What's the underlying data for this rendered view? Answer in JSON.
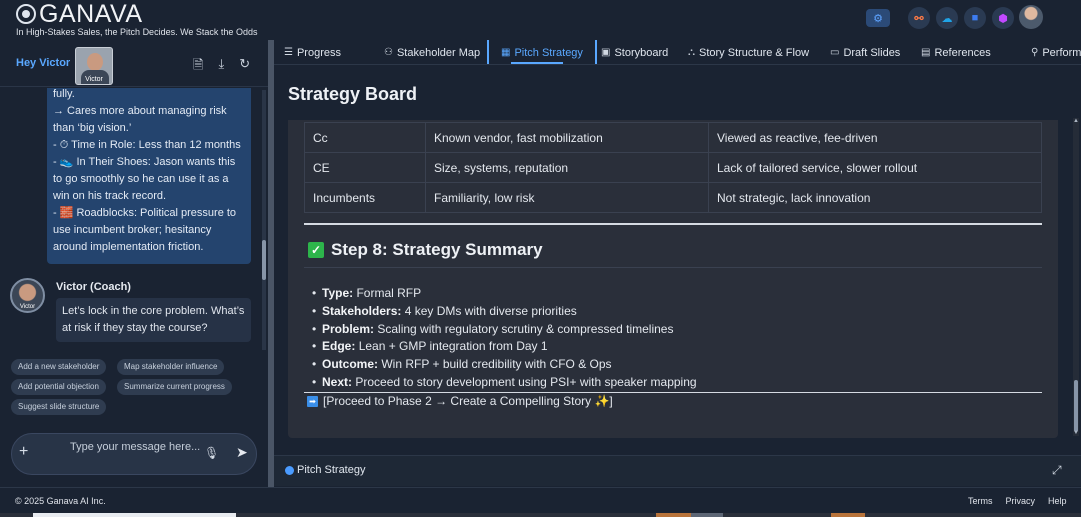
{
  "brand": {
    "name": "GANAVA",
    "tagline": "In High-Stakes Sales, the Pitch Decides. We Stack the Odds"
  },
  "top_icons": [
    "gear-icon",
    "hubspot-icon",
    "salesforce-icon",
    "app-icon",
    "gem-icon",
    "user-avatar"
  ],
  "left_panel": {
    "greeting": "Hey Victor",
    "avatar_label": "Victor",
    "user_message_lines": [
      "fully.",
      "  → Cares more about managing risk than ‘big vision.’",
      "- ⏱ Time in Role: Less than 12 months",
      "- 👟 In Their Shoes: Jason wants this to go smoothly so he can use it as a win on his track record.",
      "- 🧱 Roadblocks: Political pressure to use incumbent broker; hesitancy around implementation friction."
    ],
    "coach_name": "Victor (Coach)",
    "coach_message": "Let’s lock in the core problem. What’s at risk if they stay the course?",
    "chips": [
      "Add a new stakeholder",
      "Map stakeholder influence",
      "Add potential objection",
      "Summarize current progress",
      "Suggest slide structure"
    ],
    "input_placeholder": "Type your message here..."
  },
  "tabs": [
    {
      "label": "Progress",
      "icon": "list-icon"
    },
    {
      "label": "Stakeholder Map",
      "icon": "org-icon"
    },
    {
      "label": "Pitch Strategy",
      "icon": "board-icon",
      "active": true
    },
    {
      "label": "Storyboard",
      "icon": "note-icon"
    },
    {
      "label": "Story Structure & Flow",
      "icon": "tree-icon"
    },
    {
      "label": "Draft Slides",
      "icon": "monitor-icon"
    },
    {
      "label": "References",
      "icon": "clipboard-icon"
    },
    {
      "label": "Performa",
      "icon": "person-icon"
    }
  ],
  "board": {
    "title": "Strategy Board",
    "table_rows": [
      [
        "Cc",
        "Known vendor, fast mobilization",
        "Viewed as reactive, fee-driven"
      ],
      [
        "CE",
        "Size, systems, reputation",
        "Lack of tailored service, slower rollout"
      ],
      [
        "Incumbents",
        "Familiarity, low risk",
        "Not strategic, lack innovation"
      ]
    ],
    "step_title": "Step 8: Strategy Summary",
    "summary": [
      {
        "key": "Type:",
        "value": "Formal RFP"
      },
      {
        "key": "Stakeholders:",
        "value": "4 key DMs with diverse priorities"
      },
      {
        "key": "Problem:",
        "value": "Scaling with regulatory scrutiny & compressed timelines"
      },
      {
        "key": "Edge:",
        "value": "Lean + GMP integration from Day 1"
      },
      {
        "key": "Outcome:",
        "value": "Win RFP + build credibility with CFO & Ops"
      },
      {
        "key": "Next:",
        "value": "Proceed to story development using PSI+ with speaker mapping"
      }
    ],
    "proceed": "[Proceed to Phase 2 → Create a Compelling Story ✨]"
  },
  "status_bar": {
    "label": "Pitch Strategy"
  },
  "footer": {
    "copyright": "© 2025 Ganava AI Inc.",
    "links": [
      "Terms",
      "Privacy",
      "Help"
    ]
  }
}
